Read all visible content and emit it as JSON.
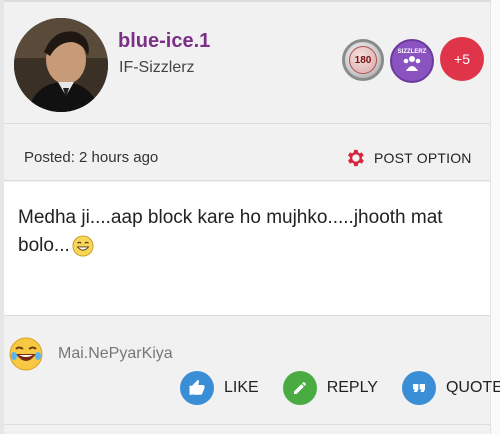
{
  "user": {
    "username": "blue-ice.1",
    "club": "IF-Sizzlerz",
    "avatar_icon": "avatar-photo-icon"
  },
  "badges": {
    "level": "180",
    "club_badge": "SIZZLERZ",
    "more": "+5"
  },
  "post_meta": {
    "posted": "Posted: 2 hours ago",
    "option_label": "POST OPTION"
  },
  "message": {
    "text": "Medha ji....aap block kare ho mujhko.....jhooth mat bolo..."
  },
  "reaction": {
    "user": "Mai.NePyarKiya"
  },
  "actions": {
    "like": "LIKE",
    "reply": "REPLY",
    "quote": "QUOTE"
  },
  "colors": {
    "username": "#7b2f87",
    "like": "#3a8ed6",
    "reply": "#4bab43",
    "quote": "#3a8ed6",
    "plus_badge": "#e0344a",
    "club_badge": "#8b53c0",
    "gear": "#d6253f"
  }
}
